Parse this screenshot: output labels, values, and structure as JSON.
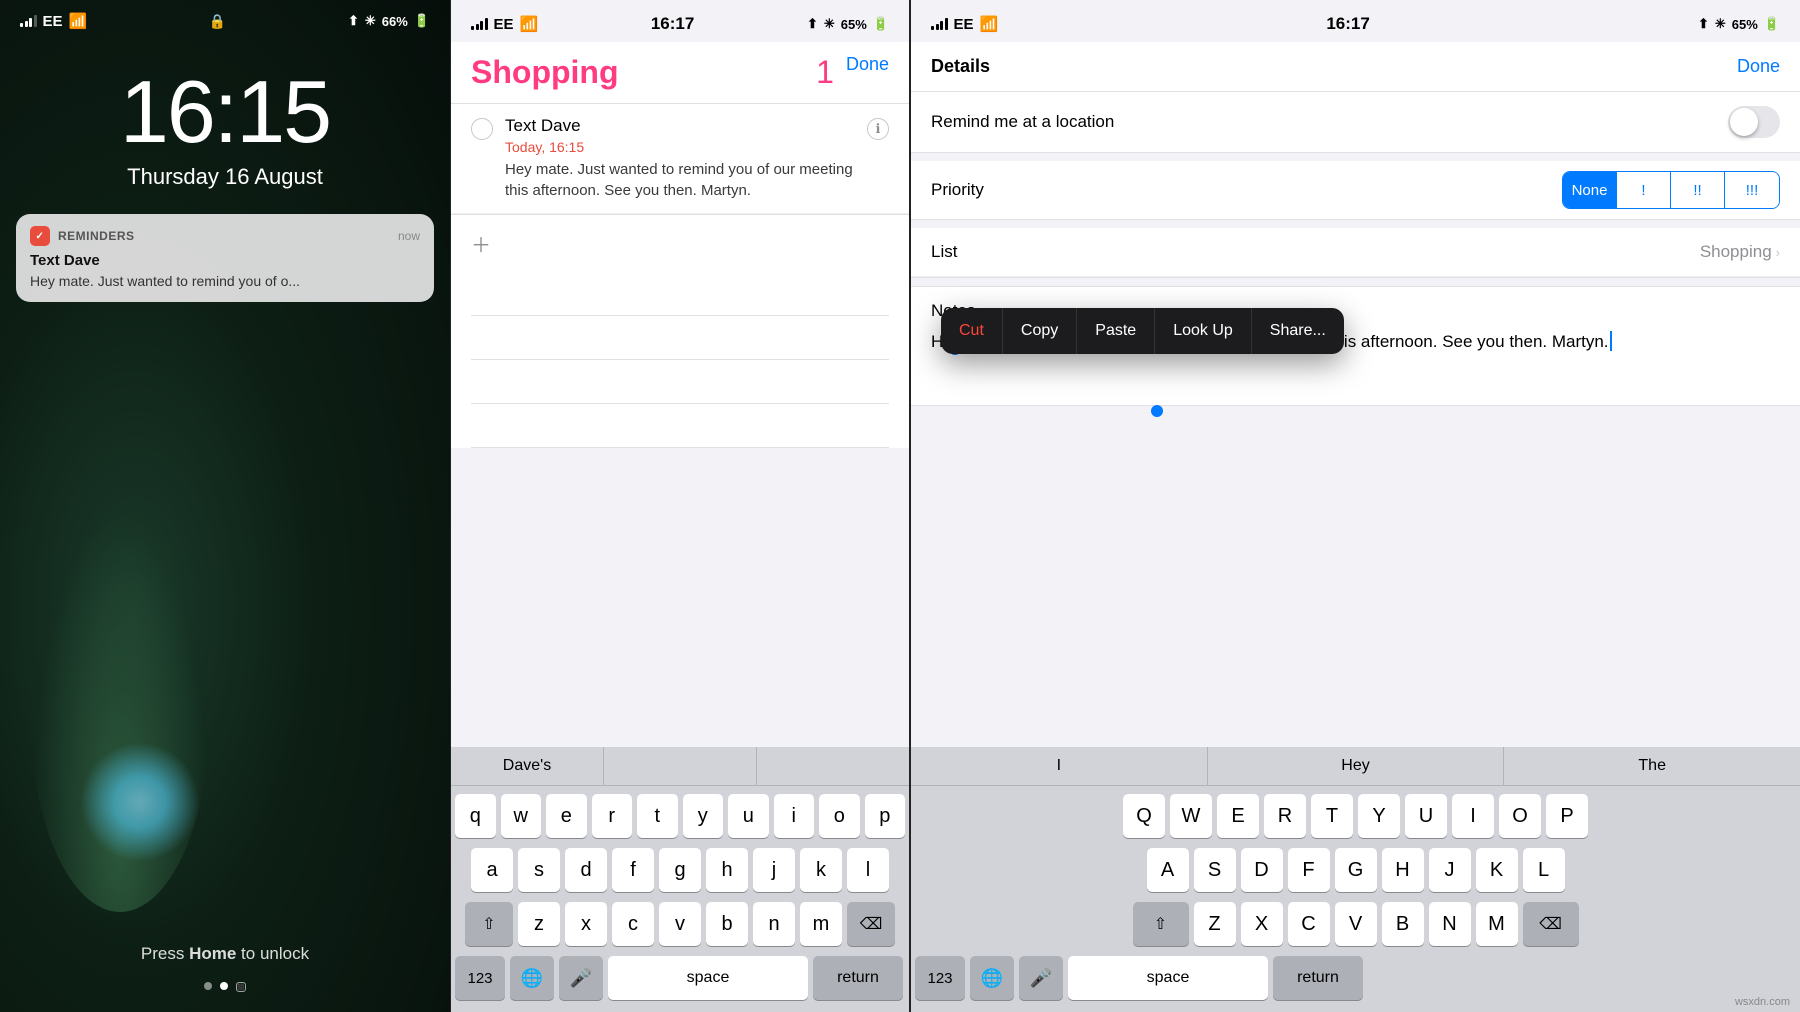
{
  "lockscreen": {
    "time": "16:15",
    "date": "Thursday 16 August",
    "status_left": "EE",
    "status_right": "66%",
    "notification": {
      "app": "REMINDERS",
      "time": "now",
      "title": "Text Dave",
      "body": "Hey mate. Just wanted to remind you of o..."
    },
    "press_home": "Press Home to unlock"
  },
  "reminders": {
    "status_left": "EE",
    "status_time": "16:17",
    "status_right": "65%",
    "title": "Shopping",
    "count": "1",
    "done_btn": "Done",
    "item": {
      "title": "Text Dave",
      "date": "Today, 16:15",
      "body": "Hey mate. Just wanted to remind you of our meeting this afternoon. See you then.  Martyn."
    },
    "keyboard": {
      "suggestions": [
        "Dave's",
        "",
        ""
      ],
      "row1": [
        "q",
        "w",
        "e",
        "r",
        "t",
        "y",
        "u",
        "i",
        "o",
        "p"
      ],
      "row2": [
        "a",
        "s",
        "d",
        "f",
        "g",
        "h",
        "j",
        "k",
        "l"
      ],
      "row3": [
        "z",
        "x",
        "c",
        "v",
        "b",
        "n",
        "m"
      ],
      "num_label": "123",
      "space_label": "space",
      "return_label": "return",
      "backspace": "⌫"
    }
  },
  "details": {
    "status_left": "EE",
    "status_time": "16:17",
    "status_right": "65%",
    "title": "Details",
    "done_btn": "Done",
    "location_label": "Remind me at a location",
    "priority_label": "Priority",
    "priority_buttons": [
      "None",
      "!",
      "!!",
      "!!!"
    ],
    "priority_active": 0,
    "list_label": "List",
    "list_value": "Shopping",
    "notes_label": "Notes",
    "notes_text": "Hey mate. Just wanted to remind you of our meeting this afternoon. See you then. Martyn.",
    "context_menu": [
      "Cut",
      "Copy",
      "Paste",
      "Look Up",
      "Share..."
    ],
    "keyboard": {
      "suggestions": [
        "I",
        "Hey",
        "The"
      ],
      "row1": [
        "Q",
        "W",
        "E",
        "R",
        "T",
        "Y",
        "U",
        "I",
        "O",
        "P"
      ],
      "row2": [
        "A",
        "S",
        "D",
        "F",
        "G",
        "H",
        "J",
        "K",
        "L"
      ],
      "row3": [
        "Z",
        "X",
        "C",
        "V",
        "B",
        "N",
        "M"
      ],
      "num_label": "123",
      "space_label": "space",
      "return_label": "return",
      "backspace": "⌫"
    }
  },
  "watermark": "wsxdn.com"
}
